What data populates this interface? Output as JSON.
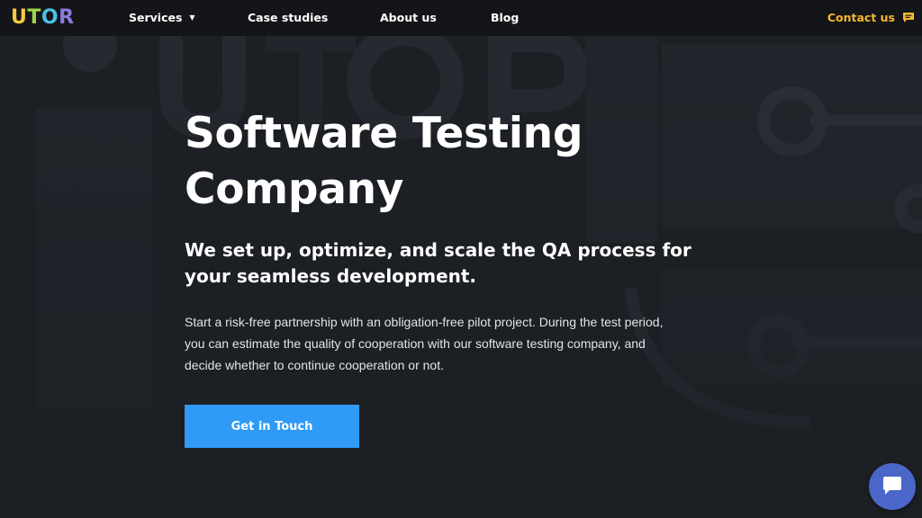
{
  "logo": {
    "letters": [
      {
        "char": "U",
        "color": "#f5c940"
      },
      {
        "char": "T",
        "color": "#9fd44a"
      },
      {
        "char": "O",
        "color": "#4bc0e8"
      },
      {
        "char": "R",
        "color": "#8a7be0"
      }
    ]
  },
  "nav": {
    "services": "Services",
    "case_studies": "Case studies",
    "about": "About us",
    "blog": "Blog",
    "contact": "Contact us"
  },
  "hero": {
    "title_line1": "Software Testing",
    "title_line2": "Company",
    "subtitle": "We set up, optimize, and scale the QA process for your seamless development.",
    "body": "Start a risk-free partnership with an obligation-free pilot project. During the test period, you can estimate the quality of cooperation with our software testing company, and decide whether to continue cooperation or not.",
    "cta": "Get in Touch"
  },
  "colors": {
    "accent": "#2f9bf6",
    "contact": "#f5b82e",
    "chat": "#4a66c9",
    "background": "#1c1f24"
  },
  "icons": {
    "services_caret": "caret-down-icon",
    "contact": "chat-icon",
    "chat_widget": "chat-bubble-icon"
  }
}
